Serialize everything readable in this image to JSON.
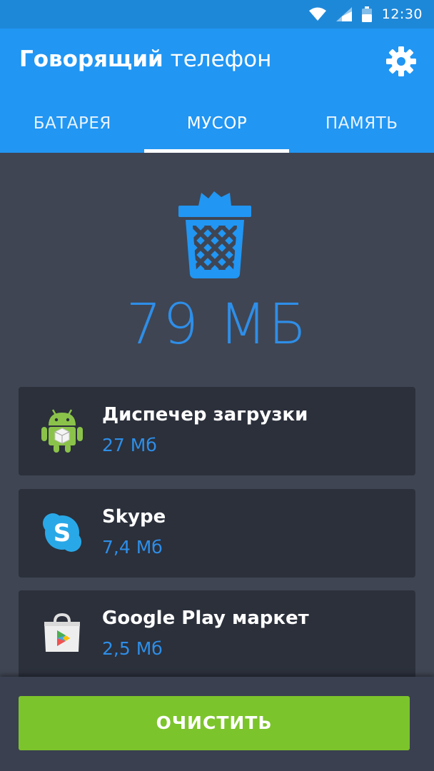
{
  "status": {
    "time": "12:30",
    "icons": [
      "wifi-icon",
      "signal-icon",
      "battery-icon"
    ]
  },
  "app": {
    "title_bold": "Говорящий",
    "title_rest": " телефон",
    "settings_icon": "gear-icon"
  },
  "tabs": [
    {
      "label": "БАТАРЕЯ",
      "active": false
    },
    {
      "label": "МУСОР",
      "active": true
    },
    {
      "label": "ПАМЯТЬ",
      "active": false
    }
  ],
  "junk": {
    "icon": "trash-icon",
    "total": "79 МБ"
  },
  "items": [
    {
      "name": "Диспечер загрузки",
      "size": "27 Мб",
      "icon": "android-icon"
    },
    {
      "name": "Skype",
      "size": "7,4 Мб",
      "icon": "skype-icon"
    },
    {
      "name": "Google Play маркет",
      "size": "2,5 Мб",
      "icon": "google-play-icon"
    }
  ],
  "action": {
    "clean_label": "ОЧИСТИТЬ"
  },
  "colors": {
    "primary": "#2196f3",
    "status_bar": "#1e88d8",
    "accent_text": "#2e8ee8",
    "background": "#3f4553",
    "card": "#2b303b",
    "button": "#7cc42b"
  }
}
